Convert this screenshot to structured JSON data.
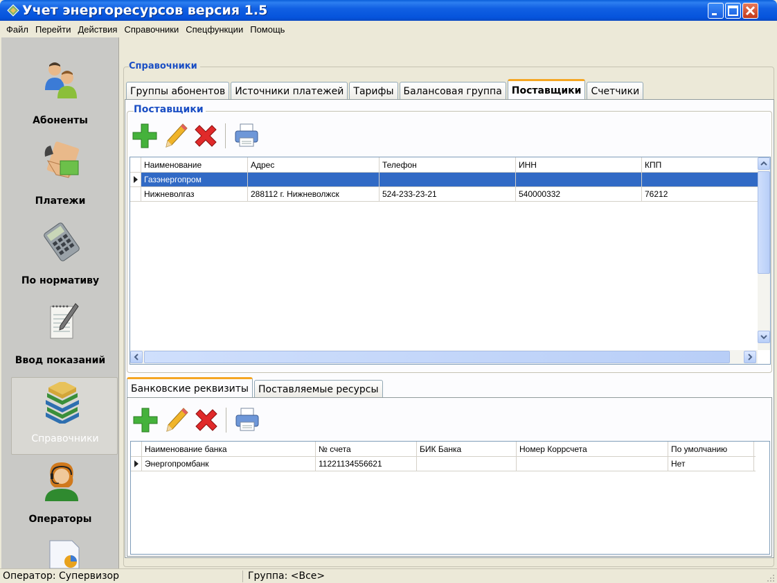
{
  "window": {
    "title": "Учет энергоресурсов версия 1.5"
  },
  "menu": [
    "Файл",
    "Перейти",
    "Действия",
    "Справочники",
    "Спецфункции",
    "Помощь"
  ],
  "nav": [
    {
      "label": "Абоненты",
      "icon": "users-icon",
      "selected": false
    },
    {
      "label": "Платежи",
      "icon": "payment-hand-icon",
      "selected": false
    },
    {
      "label": "По нормативу",
      "icon": "calculator-icon",
      "selected": false
    },
    {
      "label": "Ввод показаний",
      "icon": "notepad-pencil-icon",
      "selected": false
    },
    {
      "label": "Справочники",
      "icon": "books-icon",
      "selected": true
    },
    {
      "label": "Операторы",
      "icon": "operator-headset-icon",
      "selected": false
    }
  ],
  "section_title": "Справочники",
  "tabs": [
    "Группы абонентов",
    "Источники платежей",
    "Тарифы",
    "Балансовая группа",
    "Поставщики",
    "Счетчики"
  ],
  "active_tab": "Поставщики",
  "suppliers": {
    "group_title": "Поставщики",
    "columns": [
      "Наименование",
      "Адрес",
      "Телефон",
      "ИНН",
      "КПП"
    ],
    "rows": [
      [
        "Газэнергопром",
        "",
        "",
        "",
        ""
      ],
      [
        "Нижневолгаз",
        "288112 г. Нижневолжск",
        "524-233-23-21",
        "540000332",
        "76212"
      ]
    ]
  },
  "sub_tabs": [
    "Банковские реквизиты",
    "Поставляемые ресурсы"
  ],
  "active_sub_tab": "Банковские реквизиты",
  "bank": {
    "columns": [
      "Наименование банка",
      "№ счета",
      "БИК Банка",
      "Номер Коррсчета",
      "По умолчанию"
    ],
    "rows": [
      [
        "Энергопромбанк",
        "11221134556621",
        "",
        "",
        "Нет"
      ]
    ]
  },
  "toolbar": {
    "add": "add-icon",
    "edit": "pencil-icon",
    "delete": "delete-icon",
    "print": "printer-icon"
  },
  "status": {
    "operator": "Оператор: Супервизор",
    "group": "Группа: <Все>"
  },
  "colors": {
    "titlebar": "#0553dc",
    "selection": "#316ac5",
    "group_title": "#1a4ec4",
    "active_tab_accent": "#f5a623"
  }
}
